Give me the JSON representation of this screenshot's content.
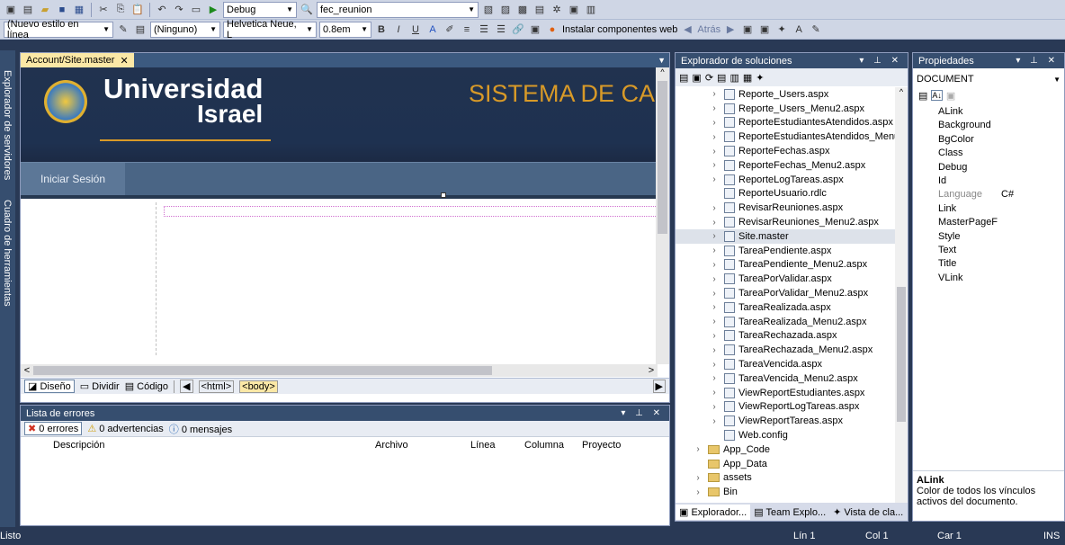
{
  "toolbar1": {
    "config": "Debug",
    "project": "fec_reunion"
  },
  "toolbar2": {
    "style": "(Nuevo estilo en línea",
    "target": "(Ninguno)",
    "font": "Helvetica Neue, L",
    "size": "0.8em",
    "install": "Instalar componentes web",
    "back": "Atrás"
  },
  "side_tabs": {
    "explorer": "Explorador de servidores",
    "toolbox": "Cuadro de herramientas"
  },
  "editor": {
    "tab": "Account/Site.master",
    "uni_title": "Universidad",
    "uni_sub": "Israel",
    "system_title": "SISTEMA DE CAR",
    "login": "Iniciar Sesión",
    "view_design": "Diseño",
    "view_split": "Dividir",
    "view_code": "Código",
    "tag_html": "<html>",
    "tag_body": "<body>"
  },
  "errors": {
    "title": "Lista de errores",
    "errors": "0 errores",
    "warnings": "0 advertencias",
    "messages": "0 mensajes",
    "columns": [
      "Descripción",
      "Archivo",
      "Línea",
      "Columna",
      "Proyecto"
    ]
  },
  "solution": {
    "title": "Explorador de soluciones",
    "items": [
      {
        "name": "Reporte_Users.aspx",
        "type": "file",
        "exp": true
      },
      {
        "name": "Reporte_Users_Menu2.aspx",
        "type": "file",
        "exp": true
      },
      {
        "name": "ReporteEstudiantesAtendidos.aspx",
        "type": "file",
        "exp": true
      },
      {
        "name": "ReporteEstudiantesAtendidos_Menu",
        "type": "file",
        "exp": true
      },
      {
        "name": "ReporteFechas.aspx",
        "type": "file",
        "exp": true
      },
      {
        "name": "ReporteFechas_Menu2.aspx",
        "type": "file",
        "exp": true
      },
      {
        "name": "ReporteLogTareas.aspx",
        "type": "file",
        "exp": true
      },
      {
        "name": "ReporteUsuario.rdlc",
        "type": "file",
        "exp": false
      },
      {
        "name": "RevisarReuniones.aspx",
        "type": "file",
        "exp": true
      },
      {
        "name": "RevisarReuniones_Menu2.aspx",
        "type": "file",
        "exp": true
      },
      {
        "name": "Site.master",
        "type": "file",
        "exp": true
      },
      {
        "name": "TareaPendiente.aspx",
        "type": "file",
        "exp": true
      },
      {
        "name": "TareaPendiente_Menu2.aspx",
        "type": "file",
        "exp": true
      },
      {
        "name": "TareaPorValidar.aspx",
        "type": "file",
        "exp": true
      },
      {
        "name": "TareaPorValidar_Menu2.aspx",
        "type": "file",
        "exp": true
      },
      {
        "name": "TareaRealizada.aspx",
        "type": "file",
        "exp": true
      },
      {
        "name": "TareaRealizada_Menu2.aspx",
        "type": "file",
        "exp": true
      },
      {
        "name": "TareaRechazada.aspx",
        "type": "file",
        "exp": true
      },
      {
        "name": "TareaRechazada_Menu2.aspx",
        "type": "file",
        "exp": true
      },
      {
        "name": "TareaVencida.aspx",
        "type": "file",
        "exp": true
      },
      {
        "name": "TareaVencida_Menu2.aspx",
        "type": "file",
        "exp": true
      },
      {
        "name": "ViewReportEstudiantes.aspx",
        "type": "file",
        "exp": true
      },
      {
        "name": "ViewReportLogTareas.aspx",
        "type": "file",
        "exp": true
      },
      {
        "name": "ViewReportTareas.aspx",
        "type": "file",
        "exp": true
      },
      {
        "name": "Web.config",
        "type": "file",
        "exp": false
      },
      {
        "name": "App_Code",
        "type": "folder",
        "exp": true,
        "root": true
      },
      {
        "name": "App_Data",
        "type": "folder",
        "exp": false,
        "root": true
      },
      {
        "name": "assets",
        "type": "folder",
        "exp": true,
        "root": true
      },
      {
        "name": "Bin",
        "type": "folder",
        "exp": true,
        "root": true
      }
    ],
    "bottom_tabs": [
      "Explorador...",
      "Team Explo...",
      "Vista de cla..."
    ]
  },
  "properties": {
    "title": "Propiedades",
    "object": "DOCUMENT",
    "rows": [
      {
        "name": "ALink",
        "value": ""
      },
      {
        "name": "Background",
        "value": ""
      },
      {
        "name": "BgColor",
        "value": ""
      },
      {
        "name": "Class",
        "value": ""
      },
      {
        "name": "Debug",
        "value": ""
      },
      {
        "name": "Id",
        "value": ""
      },
      {
        "name": "Language",
        "value": "C#"
      },
      {
        "name": "Link",
        "value": ""
      },
      {
        "name": "MasterPageF",
        "value": ""
      },
      {
        "name": "Style",
        "value": ""
      },
      {
        "name": "Text",
        "value": ""
      },
      {
        "name": "Title",
        "value": ""
      },
      {
        "name": "VLink",
        "value": ""
      }
    ],
    "desc_title": "ALink",
    "desc_text": "Color de todos los vínculos activos del documento."
  },
  "status": {
    "ready": "Listo",
    "line": "Lín 1",
    "col": "Col 1",
    "char": "Car 1",
    "ins": "INS"
  }
}
